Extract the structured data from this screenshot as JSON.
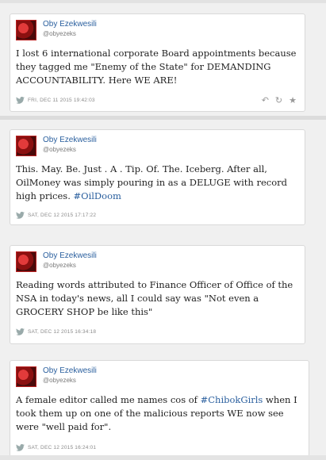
{
  "tweets": [
    {
      "name": "Oby Ezekwesili",
      "handle": "@obyezeks",
      "text": "I lost 6 international corporate Board appointments because they tagged me \"Enemy of the State\" for DEMANDING ACCOUNTABILITY. Here WE ARE!",
      "hashtag": "",
      "text_after": "",
      "timestamp": "FRI, DEC 11 2015 19:42:03"
    },
    {
      "name": "Oby Ezekwesili",
      "handle": "@obyezeks",
      "text": "This. May. Be. Just . A . Tip. Of. The. Iceberg. After all, OilMoney was simply pouring in as a DELUGE with record high prices. ",
      "hashtag": "#OilDoom",
      "text_after": "",
      "timestamp": "SAT, DEC 12 2015 17:17:22"
    },
    {
      "name": "Oby Ezekwesili",
      "handle": "@obyezeks",
      "text": "Reading words attributed to Finance Officer of Office of the NSA in today's news, all I could say was \"Not even a GROCERY SHOP be like this\"",
      "hashtag": "",
      "text_after": "",
      "timestamp": "SAT, DEC 12 2015 16:34:18"
    },
    {
      "name": "Oby Ezekwesili",
      "handle": "@obyezeks",
      "text": "A female editor called me names cos of ",
      "hashtag": "#ChibokGirls",
      "text_after": " when I took them up on one of the malicious reports WE now see were \"well paid for\".",
      "timestamp": "SAT, DEC 12 2015 16:24:01"
    }
  ],
  "colors": {
    "link": "#2a5f9e",
    "meta": "#8a8a8a"
  },
  "icons": {
    "bird": "twitter-bird-icon",
    "reply": "reply-icon",
    "retweet": "retweet-icon",
    "favorite": "star-icon"
  }
}
